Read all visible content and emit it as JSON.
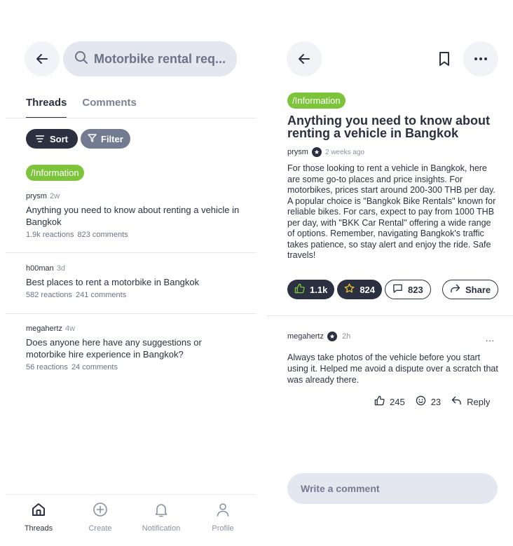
{
  "left": {
    "search": {
      "query": "Motorbike rental req..."
    },
    "tabs": [
      {
        "label": "Threads"
      },
      {
        "label": "Comments"
      }
    ],
    "sort_label": "Sort",
    "filter_label": "Filter",
    "category_tag": "/Information",
    "threads": [
      {
        "author": "prysm",
        "age": "2w",
        "title": "Anything you need to know about renting a vehicle in Bangkok",
        "reactions": "1.9k reactions",
        "comments": "823 comments"
      },
      {
        "author": "h00man",
        "age": "3d",
        "title": "Best places to rent a motorbike in Bangkok",
        "reactions": "582 reactions",
        "comments": "241 comments"
      },
      {
        "author": "megahertz",
        "age": "4w",
        "title": "Does anyone here have any suggestions or motorbike hire experience in Bangkok?",
        "reactions": "56 reactions",
        "comments": "24 comments"
      }
    ],
    "bottom_nav": [
      {
        "label": "Threads",
        "icon": "home-icon"
      },
      {
        "label": "Create",
        "icon": "plus-circle-icon"
      },
      {
        "label": "Notification",
        "icon": "bell-icon"
      },
      {
        "label": "Profile",
        "icon": "user-icon"
      }
    ]
  },
  "right": {
    "tag": "/Information",
    "title": "Anything you need to know about renting a vehicle in Bangkok",
    "author": "prysm",
    "time": "2 weeks ago",
    "body": "For those looking to rent a vehicle in Bangkok, here are some go-to places and price insights. For motorbikes, prices start around 200-300 THB per day. A popular choice is \"Bangkok Bike Rentals\" known for reliable bikes. For cars, expect to pay from 1000 THB per day, with \"BKK Car Rental\" offering a wide range of options. Remember, navigating Bangkok's traffic takes patience, so stay alert and enjoy the ride. Safe travels!",
    "likes": "1.1k",
    "stars": "824",
    "comments": "823",
    "share_label": "Share",
    "comment": {
      "author": "megahertz",
      "time": "2h",
      "more": "...",
      "text": "Always take photos of the vehicle before you start using it. Helped me avoid a dispute over a scratch that was already there.",
      "likes": "245",
      "reactions": "23",
      "reply_label": "Reply"
    },
    "input_placeholder": "Write a comment"
  },
  "colors": {
    "primary": "#2b3140",
    "accent_green": "#7cc53a",
    "muted_pill": "#737b93",
    "input_bg": "#e4e7ef",
    "star": "#f4c430"
  }
}
